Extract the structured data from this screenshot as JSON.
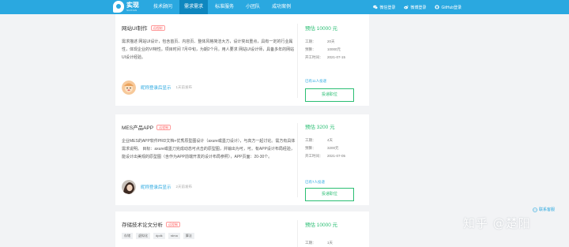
{
  "logo": {
    "cn": "实现",
    "en": "SHIXIAN"
  },
  "nav": {
    "items": [
      {
        "label": "技术顾问",
        "active": false
      },
      {
        "label": "需求需求",
        "active": true
      },
      {
        "label": "标准服务",
        "active": false
      },
      {
        "label": "小团队",
        "active": false
      },
      {
        "label": "成功案例",
        "active": false
      }
    ],
    "login": [
      {
        "label": "微信登录",
        "icon": "wechat-icon"
      },
      {
        "label": "微博登录",
        "icon": "weibo-icon"
      },
      {
        "label": "GitHub登录",
        "icon": "github-icon"
      }
    ]
  },
  "cards": [
    {
      "title": "网站UI制作",
      "tag": "远程制",
      "desc": "需求描述 网站UI设计，包含首页、内容页、整体风格简洁大方，设计突出重点，具有一定的行业属性，体现企业的VI特性。项目时间 7月中旬，为期2个月。用人要求 网站UI设计师，具备多年的网站UI设计经验。",
      "user": {
        "name": "昵称登录后显示",
        "time": "1天前发布"
      },
      "price": "预估 10000 元",
      "rows": [
        {
          "k": "工期：",
          "v": "20天"
        },
        {
          "k": "预算：",
          "v": "10000元"
        },
        {
          "k": "开工时间：",
          "v": "2021-07-15"
        }
      ],
      "applied": "已有11人投递",
      "apply_label": "投递职位"
    },
    {
      "title": "MES产品APP",
      "tag": "远程制",
      "desc": "企业MES的APP软件PRD文档+优秀原型图设计（axure或墨刀设计），与高方一起讨论。需方有具体需求说明。 目标：axure或墨刀完成动态可点击的原型图，并输出为可，可。有APP设计布局经验，能设计出美观的原型图（含作为APP前端开发的设计布局参照），APP页面：20-30个。",
      "user": {
        "name": "昵称登录后显示",
        "time": "2天前发布"
      },
      "price": "预估 3200 元",
      "rows": [
        {
          "k": "工期：",
          "v": "4天"
        },
        {
          "k": "预算：",
          "v": "3200元"
        },
        {
          "k": "开工时间：",
          "v": "2021-07-05"
        }
      ],
      "applied": "已有7人投递",
      "apply_label": "投递职位"
    },
    {
      "title": "存储技术论文分析",
      "tag": "远程制",
      "chips": [
        "存储",
        "虚拟化",
        "dpdk",
        "rdma",
        "算法"
      ],
      "price": "预估 10000 元",
      "rows": [
        {
          "k": "工期：",
          "v": "1天"
        }
      ]
    }
  ],
  "consult": "联系客服",
  "watermark": "知乎 @楚阳",
  "colors": {
    "nav": "#2aa8e0",
    "nav_active": "#0f87bf",
    "price": "#2abe73",
    "tag": "#ff5b5b"
  }
}
